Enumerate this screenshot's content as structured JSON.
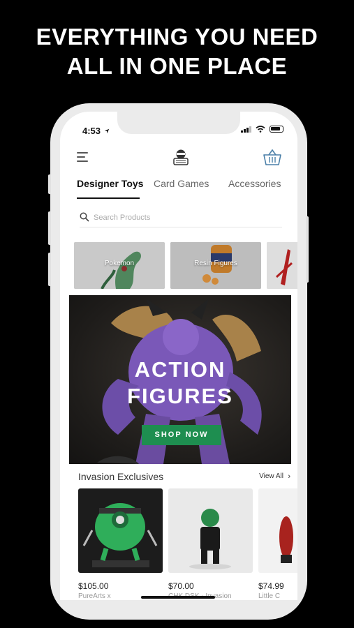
{
  "headline": {
    "line1": "EVERYTHING YOU NEED",
    "line2": "ALL IN ONE PLACE"
  },
  "status_bar": {
    "time": "4:53",
    "icons": [
      "location-arrow-icon",
      "signal-icon",
      "wifi-icon",
      "battery-icon"
    ]
  },
  "header": {
    "icons": [
      "menu-icon",
      "store-logo-icon",
      "basket-icon"
    ]
  },
  "tabs": [
    {
      "label": "Designer Toys",
      "active": true
    },
    {
      "label": "Card Games",
      "active": false
    },
    {
      "label": "Accessories",
      "active": false
    }
  ],
  "search": {
    "placeholder": "Search Products",
    "value": ""
  },
  "categories": [
    {
      "label": "Pokemon"
    },
    {
      "label": "Resin Figures"
    },
    {
      "label": ""
    }
  ],
  "hero": {
    "title_line1": "ACTION",
    "title_line2": "FIGURES",
    "button_label": "SHOP NOW",
    "accent_color": "#1e8e50"
  },
  "section": {
    "title": "Invasion Exclusives",
    "view_all_label": "View All"
  },
  "products": [
    {
      "price": "$105.00",
      "name": "PureArts x"
    },
    {
      "price": "$70.00",
      "name": "CHK DSK - Invasion"
    },
    {
      "price": "$74.99",
      "name": "Little C"
    }
  ]
}
